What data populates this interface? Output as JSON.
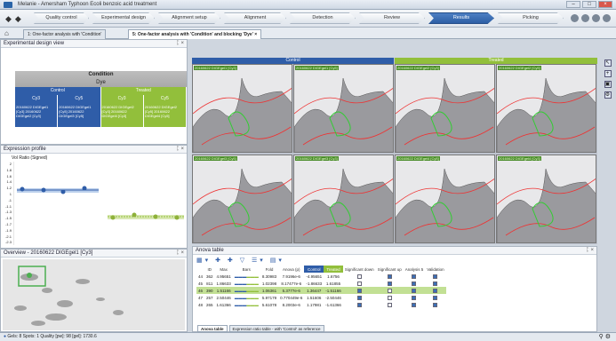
{
  "window": {
    "title": "Melanie - Amersham Typhoon Ecoli benzoic acid treatment"
  },
  "wizard": {
    "steps": [
      "Quality control",
      "Experimental design",
      "Alignment setup",
      "Alignment",
      "Detection",
      "Review",
      "Results",
      "Picking"
    ],
    "active": "Results"
  },
  "tabs": [
    "1: One-factor analysis with 'Condition'",
    "5: One-factor analysis with 'Condition' and blocking 'Dye'"
  ],
  "experimental_design": {
    "title": "Experimental design view",
    "condition": "Condition",
    "dye": "Dye",
    "groups": [
      "Control",
      "Treated"
    ],
    "dyes": [
      "Cy3",
      "Cy5",
      "Cy3",
      "Cy5"
    ],
    "samples": [
      "20160622 DIGEgel1 [Cy3] 20160622 DIGEgel2 [Cy3]",
      "20160622 DIGEgel1 [Cy5] 20160622 DIGEgel3 [Cy5]",
      "20160622 DIGEgel2 [Cy3] 20160622 DIGEgel4 [Cy3]",
      "20160622 DIGEgel2 [Cy5] 20160622 DIGEgel4 [Cy5]"
    ]
  },
  "expression_profile": {
    "title": "Expression profile",
    "ylabel": "Vol Ratio (Signed)",
    "yticks": [
      "2",
      "1.8",
      "1.6",
      "1.4",
      "1.2",
      "1",
      "-1",
      "-1.1",
      "-1.3",
      "-1.5",
      "-1.7",
      "-1.9",
      "-2.1",
      "-2.3"
    ]
  },
  "overview": {
    "title": "Overview - 20160622 DIGEgel1 [Cy3]"
  },
  "images": {
    "headers": [
      "Control",
      "Treated"
    ],
    "labels": [
      "20160622 DIGEgel1 [Cy3]",
      "20160622 DIGEgel1 [Cy5]",
      "20160622 DIGEgel2 [Cy3]",
      "20160622 DIGEgel2 [Cy5]",
      "20160622 DIGEgel3 [Cy5]",
      "20160622 DIGEgel3 [Cy3]",
      "20160622 DIGEgel4 [Cy5]",
      "20160622 DIGEgel4 [Cy3]"
    ]
  },
  "anova": {
    "title": "Anova table",
    "columns": [
      "",
      "ID",
      "Max",
      "Bars",
      "Fold",
      "Anova (p)",
      "Control",
      "Treated",
      "Significant down",
      "Significant up",
      "Analysis 5",
      "Validation"
    ],
    "rows": [
      {
        "n": "44",
        "id": "362",
        "max": "4.95651",
        "fold": "8.30983",
        "anova": "7.9196e-6",
        "c": "-4.95651",
        "t": "1.6756",
        "sd": false,
        "su": true,
        "a5": true,
        "v": true
      },
      {
        "n": "45",
        "id": "811",
        "max": "1.86633",
        "fold": "1.02398",
        "anova": "8.17477e-6",
        "c": "-1.86633",
        "t": "1.61855",
        "sd": false,
        "su": true,
        "a5": true,
        "v": true
      },
      {
        "n": "46",
        "id": "390",
        "max": "1.51166",
        "fold": "1.06361",
        "anova": "5.3777e-6",
        "c": "1.36447",
        "t": "-1.51166",
        "sd": true,
        "su": false,
        "a5": true,
        "v": true,
        "sel": true
      },
      {
        "n": "47",
        "id": "257",
        "max": "2.50446",
        "fold": "5.97179",
        "anova": "0.770449e-6",
        "c": "1.51606",
        "t": "-2.50446",
        "sd": true,
        "su": false,
        "a5": true,
        "v": true
      },
      {
        "n": "48",
        "id": "265",
        "max": "1.61366",
        "fold": "5.61078",
        "anova": "8.2003e-6",
        "c": "1.17981",
        "t": "-1.61366",
        "sd": true,
        "su": false,
        "a5": true,
        "v": true
      }
    ]
  },
  "bottom_tabs": [
    "Anova table",
    "Expression ratio table - with 'Control' as reference"
  ],
  "status": {
    "text": "Gels: 8  Spots: 1  Quality [pw]: 98 [gel]: 1730.6"
  }
}
